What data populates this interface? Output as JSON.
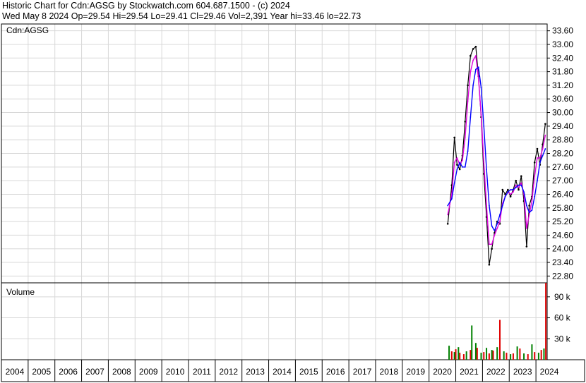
{
  "header": {
    "line1": "Historic Chart for Cdn:AGSG by Stockwatch.com 604.687.1500 - (c) 2024",
    "line2": "Wed May  8 2024  Op=29.54  Hi=29.54  Lo=29.41  Cl=29.46  Vol=2,391  Year hi=33.46  lo=22.73"
  },
  "chart_data": [
    {
      "type": "line",
      "title": "Cdn:AGSG",
      "ylim": [
        22.5,
        33.9
      ],
      "yticks": [
        "33.60",
        "33.00",
        "32.40",
        "31.80",
        "31.20",
        "30.60",
        "30.00",
        "29.40",
        "28.80",
        "28.20",
        "27.60",
        "27.00",
        "26.40",
        "25.80",
        "25.20",
        "24.60",
        "24.00",
        "23.40",
        "22.80"
      ],
      "xlim": [
        2004.0,
        2024.42
      ],
      "x_tick_labels": [
        "2004",
        "2005",
        "2006",
        "2007",
        "2008",
        "2009",
        "2010",
        "2011",
        "2012",
        "2013",
        "2014",
        "2015",
        "2016",
        "2017",
        "2018",
        "2019",
        "2020",
        "2021",
        "2022",
        "2023",
        "2024"
      ],
      "grid": true,
      "series": [
        {
          "color": "#000000",
          "x": [
            2020.7,
            2020.85,
            2020.95,
            2021.05,
            2021.15,
            2021.25,
            2021.35,
            2021.45,
            2021.55,
            2021.65,
            2021.75,
            2021.85,
            2021.95,
            2022.05,
            2022.15,
            2022.25,
            2022.35,
            2022.45,
            2022.55,
            2022.65,
            2022.75,
            2022.85,
            2022.95,
            2023.05,
            2023.15,
            2023.25,
            2023.35,
            2023.45,
            2023.55,
            2023.65,
            2023.75,
            2023.85,
            2023.95,
            2024.05,
            2024.15,
            2024.25,
            2024.35
          ],
          "y": [
            25.1,
            26.8,
            28.9,
            27.7,
            27.5,
            28.1,
            29.6,
            31.2,
            32.5,
            32.8,
            32.9,
            31.6,
            29.8,
            27.3,
            25.4,
            23.3,
            24.0,
            24.7,
            25.2,
            25.1,
            26.6,
            26.4,
            26.6,
            26.3,
            26.6,
            27.0,
            26.6,
            27.2,
            26.1,
            24.1,
            25.9,
            26.3,
            27.8,
            28.4,
            27.7,
            28.6,
            29.5
          ]
        },
        {
          "color": "#e000e0",
          "x": [
            2020.7,
            2020.85,
            2020.95,
            2021.05,
            2021.15,
            2021.25,
            2021.35,
            2021.45,
            2021.55,
            2021.65,
            2021.75,
            2021.85,
            2021.95,
            2022.05,
            2022.15,
            2022.25,
            2022.35,
            2022.45,
            2022.55,
            2022.65,
            2022.75,
            2022.85,
            2022.95,
            2023.05,
            2023.15,
            2023.25,
            2023.35,
            2023.45,
            2023.55,
            2023.65,
            2023.75,
            2023.85,
            2023.95,
            2024.05,
            2024.15,
            2024.25,
            2024.35
          ],
          "y": [
            25.5,
            26.4,
            27.8,
            28.0,
            27.7,
            27.9,
            28.9,
            30.5,
            31.8,
            32.3,
            32.5,
            31.5,
            29.9,
            27.8,
            25.9,
            24.2,
            24.2,
            24.6,
            24.9,
            25.2,
            26.0,
            26.3,
            26.5,
            26.4,
            26.5,
            26.8,
            26.7,
            26.9,
            26.4,
            24.9,
            25.5,
            26.1,
            27.2,
            28.0,
            28.0,
            28.4,
            29.0
          ]
        },
        {
          "color": "#0000ff",
          "x": [
            2020.7,
            2020.85,
            2020.95,
            2021.05,
            2021.15,
            2021.25,
            2021.35,
            2021.45,
            2021.55,
            2021.65,
            2021.75,
            2021.85,
            2021.95,
            2022.05,
            2022.15,
            2022.25,
            2022.35,
            2022.45,
            2022.55,
            2022.65,
            2022.75,
            2022.85,
            2022.95,
            2023.05,
            2023.15,
            2023.25,
            2023.35,
            2023.45,
            2023.55,
            2023.65,
            2023.75,
            2023.85,
            2023.95,
            2024.05,
            2024.15,
            2024.25,
            2024.35
          ],
          "y": [
            25.9,
            26.2,
            26.9,
            27.5,
            27.8,
            27.6,
            27.6,
            28.3,
            29.8,
            31.2,
            31.9,
            32.0,
            31.1,
            29.4,
            27.5,
            25.9,
            25.0,
            24.8,
            25.1,
            25.5,
            25.9,
            26.3,
            26.5,
            26.6,
            26.6,
            26.7,
            26.8,
            26.8,
            26.5,
            25.9,
            25.6,
            25.7,
            26.3,
            27.0,
            27.8,
            28.1,
            28.4
          ]
        }
      ]
    },
    {
      "type": "bar",
      "title": "Volume",
      "ylim": [
        0,
        110
      ],
      "yticks": [
        "90 k",
        "60 k",
        "30 k"
      ],
      "xlim": [
        2004.0,
        2024.42
      ],
      "series": [
        {
          "name": "",
          "color": "#e00000",
          "x": [
            2020.85,
            2021.0,
            2021.15,
            2021.3,
            2021.55,
            2021.8,
            2022.05,
            2022.25,
            2022.4,
            2022.65,
            2022.9,
            2023.15,
            2023.4,
            2023.7,
            2023.95,
            2024.2,
            2024.37
          ],
          "values": [
            12,
            15,
            10,
            8,
            14,
            17,
            11,
            9,
            13,
            57,
            10,
            9,
            16,
            8,
            11,
            14,
            110
          ]
        },
        {
          "name": "",
          "color": "#008000",
          "x": [
            2020.75,
            2020.95,
            2021.1,
            2021.4,
            2021.6,
            2021.75,
            2021.95,
            2022.15,
            2022.35,
            2022.55,
            2022.8,
            2023.05,
            2023.3,
            2023.55,
            2023.85,
            2024.1,
            2024.3
          ],
          "values": [
            20,
            11,
            18,
            12,
            49,
            24,
            10,
            17,
            14,
            18,
            12,
            8,
            19,
            9,
            22,
            10,
            16
          ]
        }
      ]
    }
  ]
}
